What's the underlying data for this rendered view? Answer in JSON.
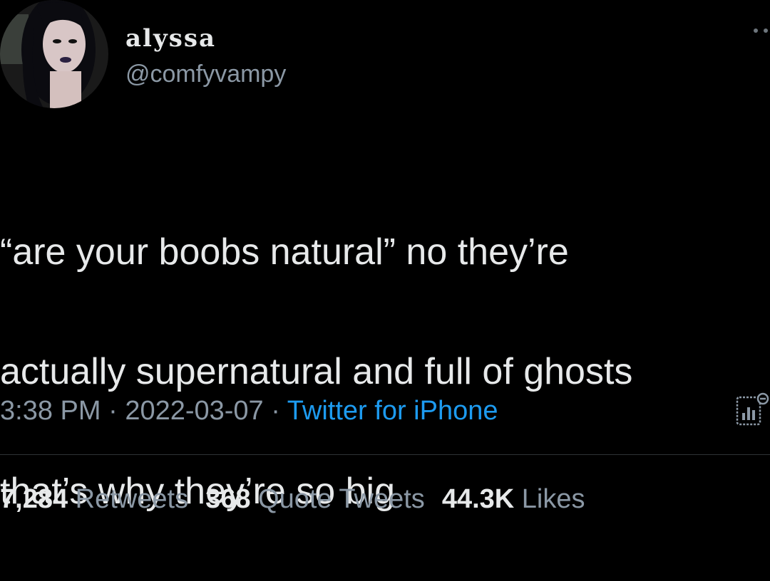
{
  "author": {
    "display_name": "alyssa",
    "handle": "@comfyvampy"
  },
  "tweet": {
    "text_lines": [
      "“are your boobs natural” no they’re",
      "actually supernatural and full of ghosts",
      "that’s why they’re so big"
    ]
  },
  "meta": {
    "time": "3:38 PM",
    "separator": "·",
    "date": "2022-03-07",
    "source": "Twitter for iPhone"
  },
  "stats": {
    "retweets_count": "7,284",
    "retweets_label": "Retweets",
    "quotes_count": "368",
    "quotes_label": "Quote Tweets",
    "likes_count": "44.3K",
    "likes_label": "Likes"
  },
  "icons": {
    "more": "more-options-icon",
    "analytics": "tweet-analytics-icon"
  },
  "colors": {
    "background": "#000000",
    "text": "#e7e9ea",
    "secondary": "#8b98a5",
    "link": "#1d9bf0",
    "divider": "#2f3336"
  }
}
